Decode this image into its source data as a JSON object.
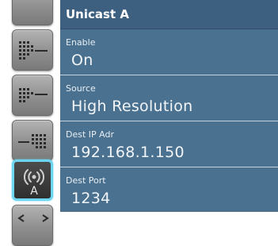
{
  "sidebar": {
    "buttons": [
      {
        "icon": "signal-bars-icon"
      },
      {
        "icon": "signal-bars-right-icon"
      },
      {
        "icon": "signal-bars-left-icon"
      },
      {
        "icon": "antenna-a-icon",
        "letter": "A"
      },
      {
        "icon": "arrows-icon"
      }
    ]
  },
  "panel": {
    "title": "Unicast A",
    "fields": [
      {
        "label": "Enable",
        "value": "On"
      },
      {
        "label": "Source",
        "value": "High Resolution"
      },
      {
        "label": "Dest IP Adr",
        "value": "192.168.1.150"
      },
      {
        "label": "Dest Port",
        "value": "1234"
      }
    ]
  },
  "colors": {
    "panel_bg": "#4a7190",
    "title_bg": "#3d6080",
    "divider": "#c3d2df",
    "active_highlight": "#6cd6f2"
  }
}
